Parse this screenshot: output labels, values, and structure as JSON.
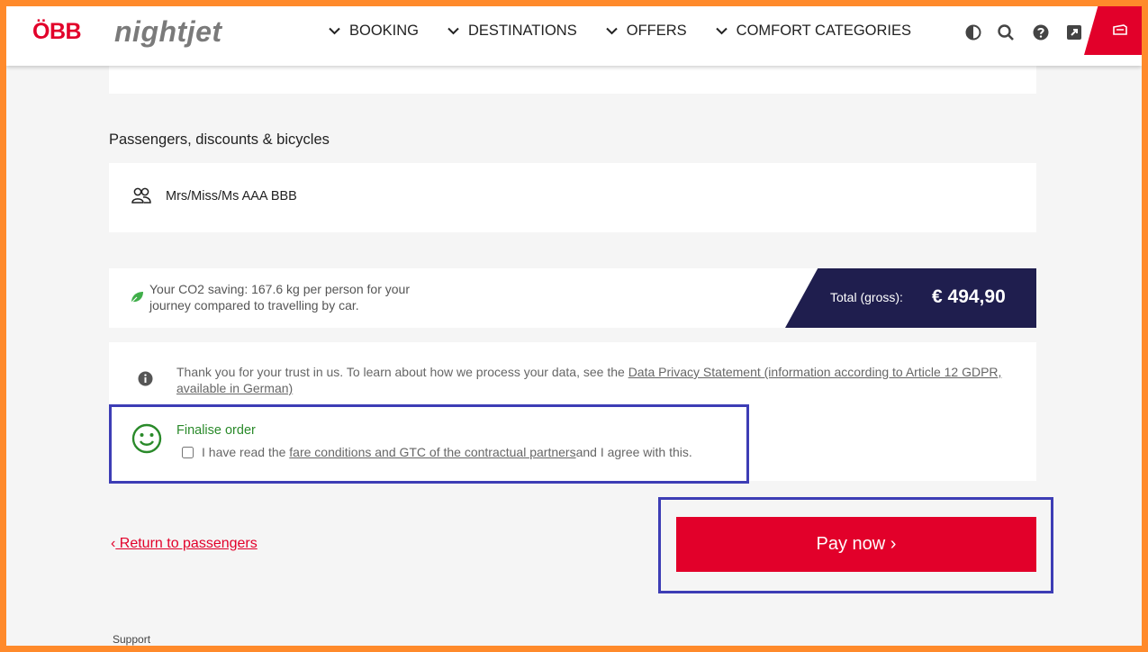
{
  "header": {
    "logo_obb": "ÖBB",
    "logo_nightjet": "nightjet",
    "nav": [
      {
        "label": "BOOKING"
      },
      {
        "label": "DESTINATIONS"
      },
      {
        "label": "OFFERS"
      },
      {
        "label": "COMFORT CATEGORIES"
      }
    ],
    "icons": [
      "contrast-icon",
      "search-icon",
      "help-icon",
      "external-link-icon",
      "ticket-icon"
    ]
  },
  "passengers": {
    "section_title": "Passengers, discounts & bicycles",
    "name": "Mrs/Miss/Ms AAA BBB"
  },
  "summary": {
    "co2_text": "Your CO2 saving: 167.6 kg per person for your journey compared to travelling by car.",
    "total_label": "Total (gross):",
    "total_value": "€ 494,90"
  },
  "privacy": {
    "text_before": "Thank you for your trust in us. To learn about how we process your data, see the ",
    "link": "Data Privacy Statement (information according to Article 12 GDPR, available in German)"
  },
  "order": {
    "title": "Finalise order",
    "agree_before": "I have read the ",
    "agree_link": "fare conditions and GTC of the contractual partners",
    "agree_after": " and I agree with this."
  },
  "actions": {
    "return_label": " Return to passengers",
    "pay_label": "Pay now ›"
  },
  "footer": {
    "support": "Support"
  },
  "colors": {
    "brand_red": "#e2002a",
    "total_bg": "#1f1e4e",
    "highlight": "#3d3db5",
    "frame": "#ff8a2b"
  }
}
